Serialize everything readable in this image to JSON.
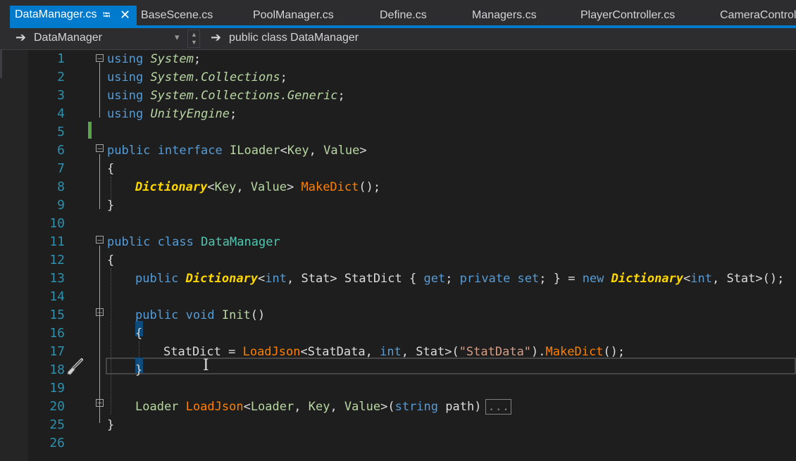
{
  "tabs": [
    {
      "label": "DataManager.cs",
      "active": true,
      "pin_glyph": "⭾",
      "close_glyph": "✕"
    },
    {
      "label": "BaseScene.cs"
    },
    {
      "label": "PoolManager.cs"
    },
    {
      "label": "Define.cs"
    },
    {
      "label": "Managers.cs"
    },
    {
      "label": "PlayerController.cs"
    },
    {
      "label": "CameraControl"
    }
  ],
  "navbar": {
    "type_dropdown": "DataManager",
    "member_dropdown": "public class DataManager",
    "arrow_glyph": "➔",
    "dropdown_glyph": "▾"
  },
  "line_numbers": [
    "1",
    "2",
    "3",
    "4",
    "5",
    "6",
    "7",
    "8",
    "9",
    "10",
    "11",
    "12",
    "13",
    "14",
    "15",
    "16",
    "17",
    "18",
    "19",
    "20",
    "25",
    "26"
  ],
  "code": {
    "l1_kw": "using",
    "l1_ns": "System",
    "l1_p": ";",
    "l2_kw": "using",
    "l2_ns": "System.Collections",
    "l2_p": ";",
    "l3_kw": "using",
    "l3_ns": "System.Collections.Generic",
    "l3_p": ";",
    "l4_kw": "using",
    "l4_ns": "UnityEngine",
    "l4_p": ";",
    "l6_kw": "public interface",
    "l6_name": "ILoader",
    "l6_lt": "<",
    "l6_t1": "Key",
    "l6_c": ", ",
    "l6_t2": "Value",
    "l6_gt": ">",
    "l7": "{",
    "l8_ty": "Dictionary",
    "l8_lt": "<",
    "l8_t1": "Key",
    "l8_c": ", ",
    "l8_t2": "Value",
    "l8_gt": "> ",
    "l8_fn": "MakeDict",
    "l8_end": "();",
    "l9": "}",
    "l11_kw": "public class",
    "l11_name": "DataManager",
    "l12": "{",
    "l13_kw": "public",
    "l13_ty": "Dictionary",
    "l13_a": "<",
    "l13_int": "int",
    "l13_b": ", Stat> StatDict { ",
    "l13_get": "get",
    "l13_c": "; ",
    "l13_priv": "private set",
    "l13_d": "; } = ",
    "l13_new": "new",
    "l13_ty2": "Dictionary",
    "l13_e": "<",
    "l13_int2": "int",
    "l13_f": ", Stat>();",
    "l15_kw": "public void",
    "l15_fn": "Init",
    "l15_end": "()",
    "l16": "{",
    "l17_a": "StatDict = ",
    "l17_fn": "LoadJson",
    "l17_b": "<StatData, ",
    "l17_int": "int",
    "l17_c": ", Stat>(",
    "l17_str": "\"StatData\"",
    "l17_d": ").",
    "l17_fn2": "MakeDict",
    "l17_e": "();",
    "l18": "}",
    "l20_ty": "Loader",
    "l20_fn": "LoadJson",
    "l20_a": "<",
    "l20_t1": "Loader",
    "l20_c1": ", ",
    "l20_t2": "Key",
    "l20_c2": ", ",
    "l20_t3": "Value",
    "l20_b": ">(",
    "l20_kw": "string",
    "l20_p": " path)",
    "l20_box": "...",
    "l25": "}"
  },
  "colors": {
    "accent": "#007acc",
    "keyword": "#569cd6",
    "type": "#4ec9b0",
    "type_param": "#b8d7a3",
    "method": "#ff8000",
    "line_number": "#2b91af",
    "change_marker": "#57a64a"
  },
  "icons": [
    "pin-icon",
    "close-icon",
    "arrow-right-icon",
    "chevron-down-icon",
    "fold-collapse-icon",
    "fold-expand-icon",
    "quick-actions-brush-icon",
    "text-cursor-icon"
  ]
}
